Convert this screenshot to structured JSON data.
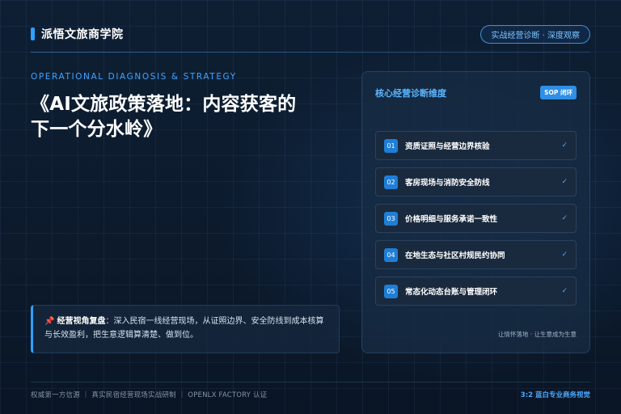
{
  "header": {
    "brand": "派悟文旅商学院",
    "badge": "实战经营诊断 · 深度观察"
  },
  "hero": {
    "eyebrow": "OPERATIONAL DIAGNOSIS & STRATEGY",
    "title_line1": "《AI文旅政策落地：内容获客的",
    "title_line2": "下一个分水岭》"
  },
  "insight": {
    "icon": "pushpin-icon",
    "label": "经营视角复盘",
    "text": "：深入民宿一线经营现场，从证照边界、安全防线到成本核算与长效盈利，把生意逻辑算清楚、做到位。"
  },
  "panel": {
    "title": "核心经营诊断维度",
    "tag": "SOP 闭环",
    "items": [
      {
        "num": "01",
        "label": "资质证照与经营边界核验",
        "check": "✓"
      },
      {
        "num": "02",
        "label": "客房现场与消防安全防线",
        "check": "✓"
      },
      {
        "num": "03",
        "label": "价格明细与服务承诺一致性",
        "check": "✓"
      },
      {
        "num": "04",
        "label": "在地生态与社区村规民约协同",
        "check": "✓"
      },
      {
        "num": "05",
        "label": "常态化动态台账与管理闭环",
        "check": "✓"
      }
    ],
    "footer": "让情怀落地 · 让生意成为生意"
  },
  "footer": {
    "left": "权威第一方信源 ｜ 真实民宿经营现场实战研制 ｜ OPENLX FACTORY 认证",
    "right": "3:2 蓝白专业商务视觉"
  },
  "colors": {
    "accent": "#2ea0ff",
    "background": "#0e1f33"
  }
}
